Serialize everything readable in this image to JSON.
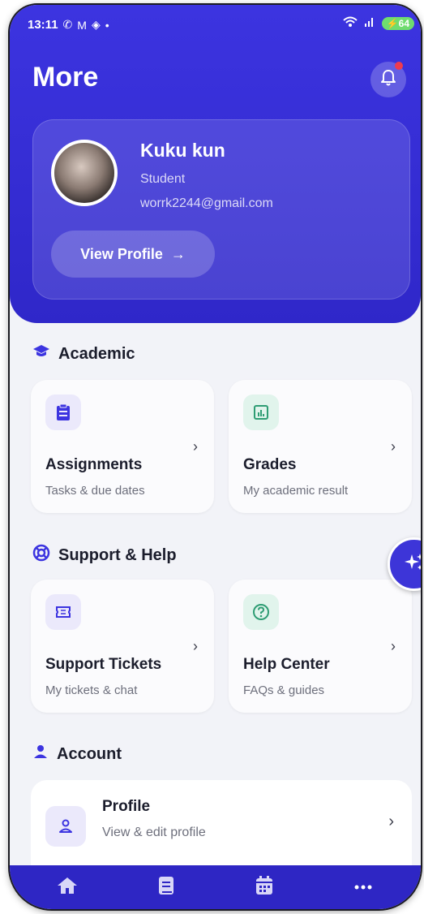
{
  "status_bar": {
    "time": "13:11",
    "battery": "64"
  },
  "header": {
    "title": "More"
  },
  "profile": {
    "name": "Kuku kun",
    "role": "Student",
    "email": "worrk2244@gmail.com",
    "view_button": "View Profile"
  },
  "sections": {
    "academic": "Academic",
    "support": "Support & Help",
    "account": "Account"
  },
  "cards": {
    "assignments": {
      "title": "Assignments",
      "subtitle": "Tasks & due dates",
      "icon": "clipboard-icon"
    },
    "grades": {
      "title": "Grades",
      "subtitle": "My academic result",
      "icon": "chart-icon"
    },
    "tickets": {
      "title": "Support Tickets",
      "subtitle": "My tickets & chat",
      "icon": "ticket-icon"
    },
    "help": {
      "title": "Help Center",
      "subtitle": "FAQs & guides",
      "icon": "question-icon"
    }
  },
  "account_items": [
    {
      "title": "Profile",
      "subtitle": "View & edit profile",
      "icon": "user-icon"
    }
  ],
  "bottom_nav": [
    {
      "icon": "home-icon"
    },
    {
      "icon": "book-icon"
    },
    {
      "icon": "calendar-icon"
    },
    {
      "icon": "more-icon"
    }
  ],
  "colors": {
    "primary": "#3c34e0",
    "background": "#f2f3f8",
    "notification_dot": "#ef3b4e"
  }
}
